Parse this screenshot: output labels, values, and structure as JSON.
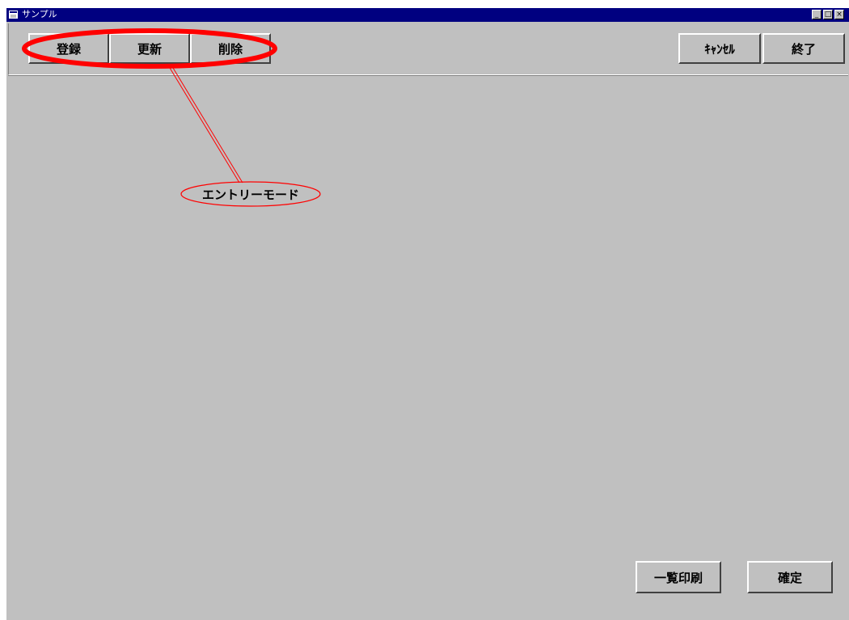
{
  "window": {
    "title": "サンプル",
    "controls": [
      "minimize-icon",
      "maximize-icon",
      "close-icon"
    ]
  },
  "toolbar": {
    "register_label": "登録",
    "update_label": "更新",
    "delete_label": "削除",
    "cancel_label": "ｷｬﾝｾﾙ",
    "exit_label": "終了"
  },
  "footer": {
    "print_list_label": "一覧印刷",
    "confirm_label": "確定"
  },
  "annotation": {
    "label": "エントリーモード",
    "color": "#ff0000"
  },
  "colors": {
    "titlebar": "#000080",
    "window_bg": "#c0c0c0"
  }
}
